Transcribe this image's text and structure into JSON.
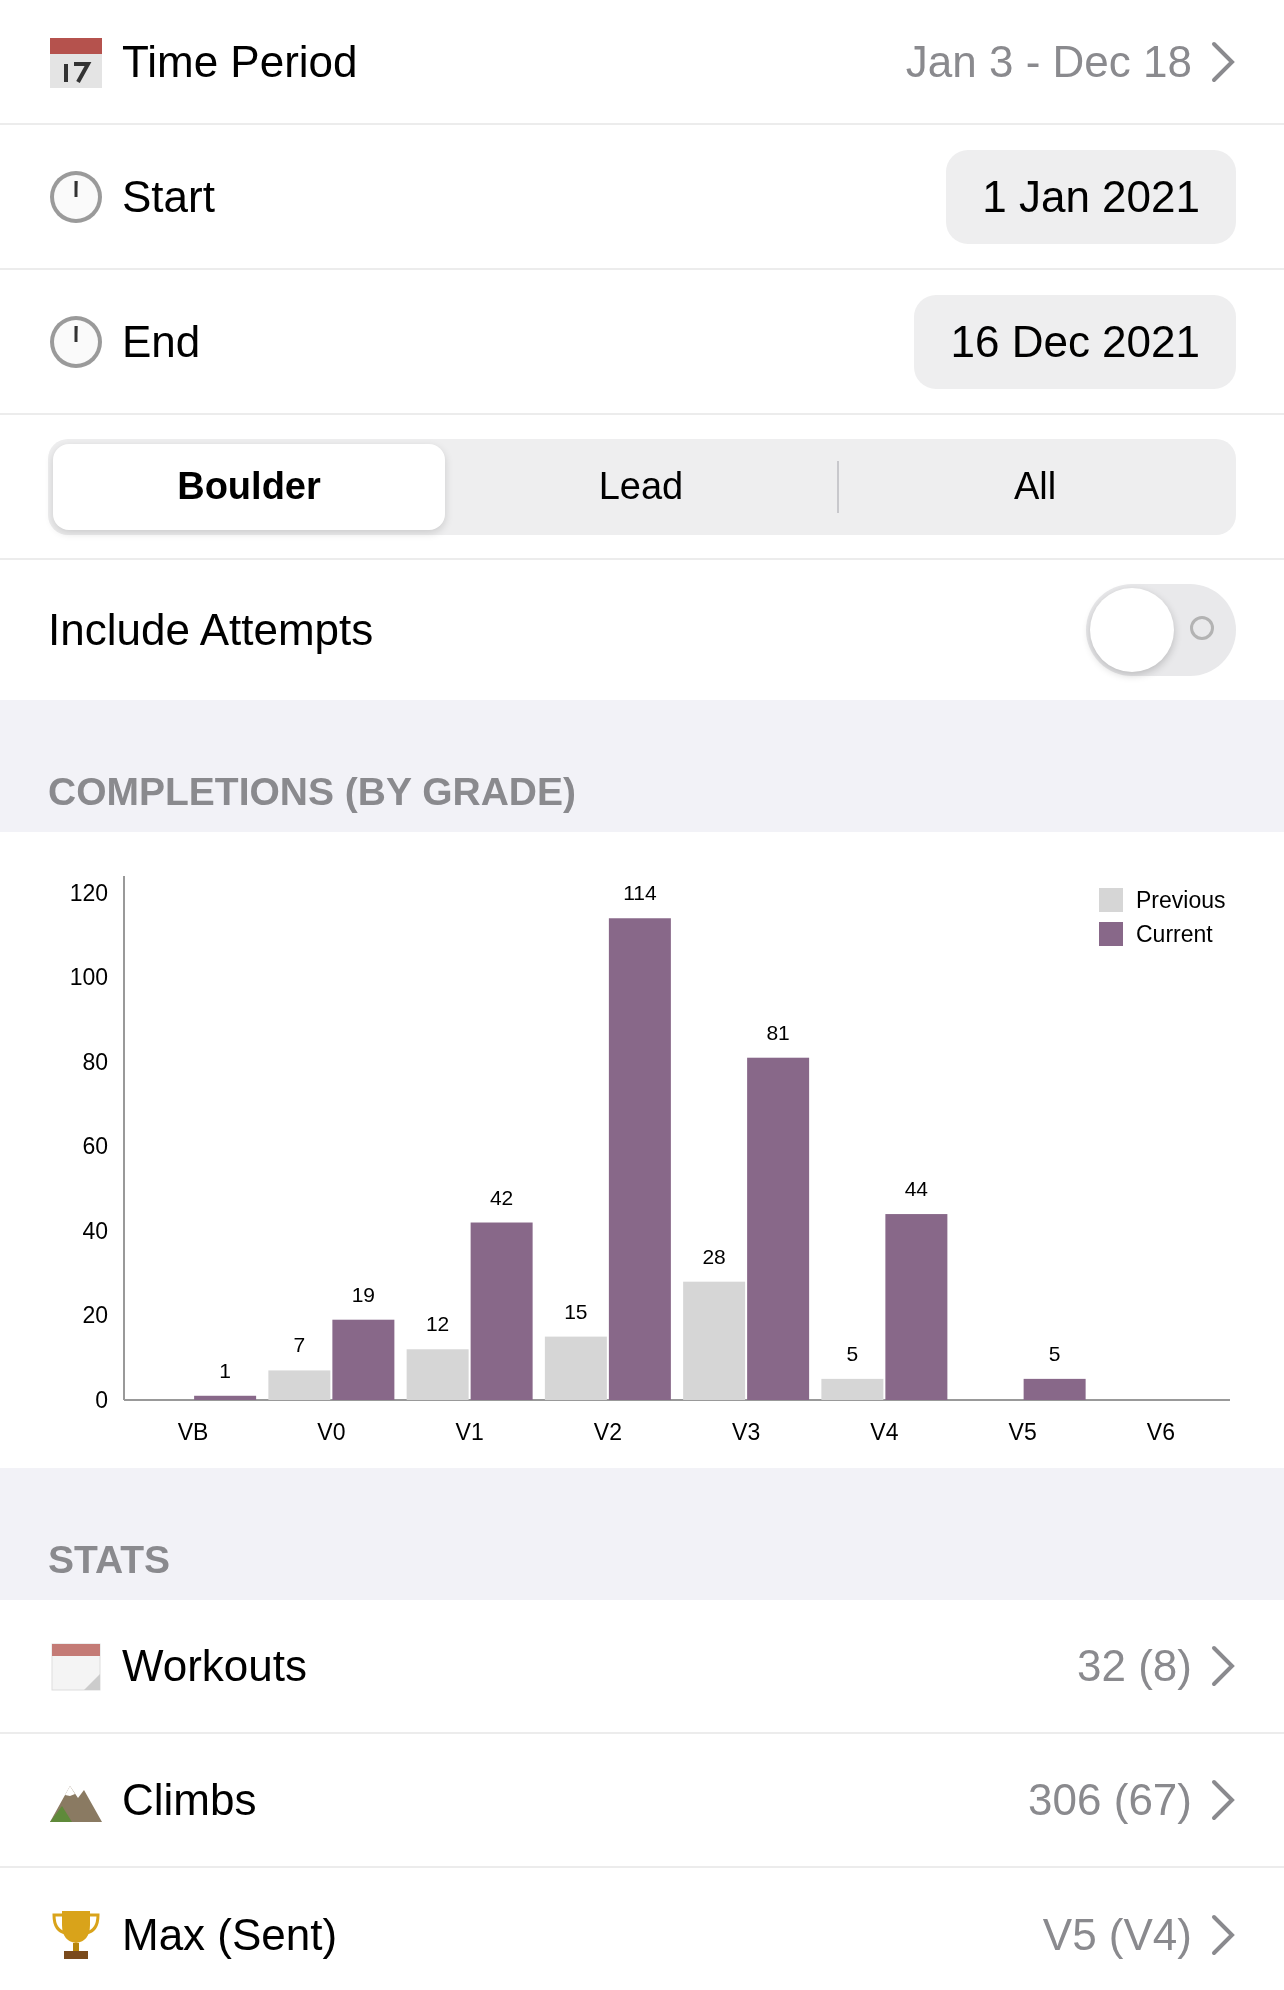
{
  "time_period": {
    "label": "Time Period",
    "value": "Jan 3 - Dec 18"
  },
  "date_rows": [
    {
      "label": "Start",
      "value": "1 Jan 2021"
    },
    {
      "label": "End",
      "value": "16 Dec 2021"
    }
  ],
  "segments": [
    {
      "label": "Boulder",
      "selected": true
    },
    {
      "label": "Lead",
      "selected": false
    },
    {
      "label": "All",
      "selected": false
    }
  ],
  "include_attempts": {
    "label": "Include Attempts",
    "on": false
  },
  "completions": {
    "header": "COMPLETIONS (BY GRADE)",
    "chart_data": {
      "type": "bar",
      "categories": [
        "VB",
        "V0",
        "V1",
        "V2",
        "V3",
        "V4",
        "V5",
        "V6"
      ],
      "series": [
        {
          "name": "Previous",
          "color": "#d6d6d6",
          "values": [
            null,
            7,
            12,
            15,
            28,
            5,
            null,
            null
          ]
        },
        {
          "name": "Current",
          "color": "#886889",
          "values": [
            1,
            19,
            42,
            114,
            81,
            44,
            5,
            null
          ]
        }
      ],
      "legend": "top-right",
      "ylim": [
        0,
        124
      ],
      "yticks": [
        0,
        20,
        40,
        60,
        80,
        100,
        120
      ],
      "data_labels": true
    }
  },
  "stats": {
    "header": "STATS",
    "rows": [
      {
        "kind": "workouts",
        "label": "Workouts",
        "value": "32 (8)"
      },
      {
        "kind": "climbs",
        "label": "Climbs",
        "value": "306 (67)"
      },
      {
        "kind": "max",
        "label": "Max (Sent)",
        "value": "V5 (V4)"
      }
    ]
  }
}
